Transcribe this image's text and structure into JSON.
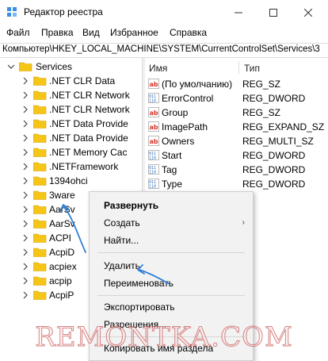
{
  "window": {
    "title": "Редактор реестра",
    "minimize_icon": "minimize-icon",
    "maximize_icon": "maximize-icon",
    "close_icon": "close-icon"
  },
  "menu": [
    "Файл",
    "Правка",
    "Вид",
    "Избранное",
    "Справка"
  ],
  "address": "Компьютер\\HKEY_LOCAL_MACHINE\\SYSTEM\\CurrentControlSet\\Services\\3",
  "tree": {
    "root": "Services",
    "items": [
      ".NET CLR Data",
      ".NET CLR Network",
      ".NET CLR Network",
      ".NET Data Provide",
      ".NET Data Provide",
      ".NET Memory Cac",
      ".NETFramework",
      "1394ohci",
      "3ware",
      "AarSv",
      "AarSv",
      "ACPI",
      "AcpiD",
      "acpiex",
      "acpip",
      "AcpiP"
    ]
  },
  "list": {
    "columns": {
      "name": "Имя",
      "type": "Тип"
    },
    "rows": [
      {
        "name": "(По умолчанию)",
        "type": "REG_SZ",
        "icon": "string-value-icon"
      },
      {
        "name": "ErrorControl",
        "type": "REG_DWORD",
        "icon": "binary-value-icon"
      },
      {
        "name": "Group",
        "type": "REG_SZ",
        "icon": "string-value-icon"
      },
      {
        "name": "ImagePath",
        "type": "REG_EXPAND_SZ",
        "icon": "string-value-icon"
      },
      {
        "name": "Owners",
        "type": "REG_MULTI_SZ",
        "icon": "string-value-icon"
      },
      {
        "name": "Start",
        "type": "REG_DWORD",
        "icon": "binary-value-icon"
      },
      {
        "name": "Tag",
        "type": "REG_DWORD",
        "icon": "binary-value-icon"
      },
      {
        "name": "Type",
        "type": "REG_DWORD",
        "icon": "binary-value-icon"
      }
    ]
  },
  "context_menu": {
    "expand": "Развернуть",
    "create": "Создать",
    "find": "Найти...",
    "delete": "Удалить",
    "rename": "Переименовать",
    "export": "Экспортировать",
    "permissions": "Разрешения...",
    "copy_key_name": "Копировать имя раздела"
  },
  "watermark": "REMONTKA.COM",
  "colors": {
    "folder": "#f5c518",
    "annotation_arrow": "#2f7fd6",
    "string_icon": "#d9342b",
    "binary_icon": "#2f6fbf"
  }
}
